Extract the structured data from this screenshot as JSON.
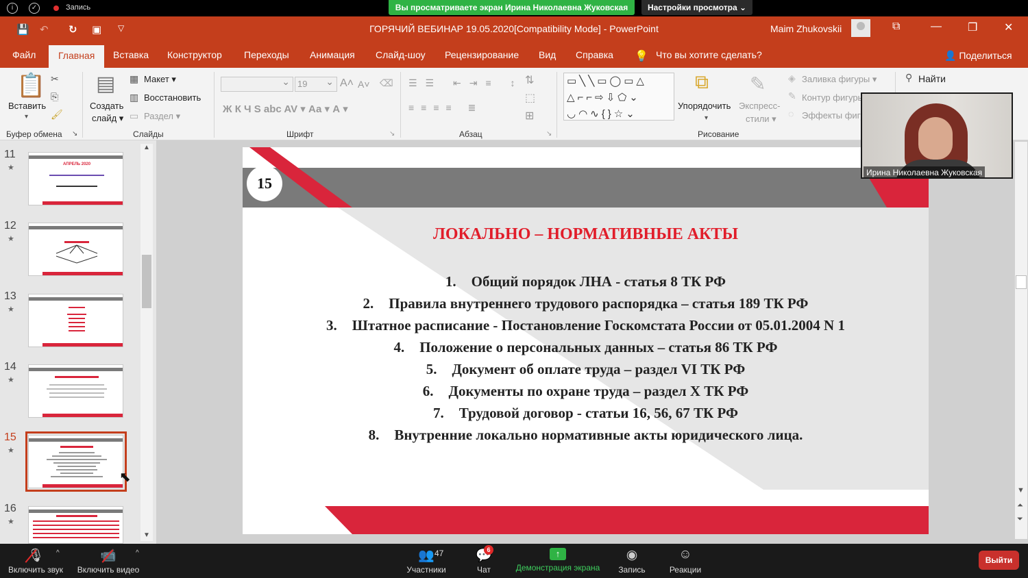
{
  "zoom_top": {
    "recording": "Запись",
    "share_banner": "Вы просматриваете экран Ирина Николаевна Жуковская",
    "view_settings": "Настройки просмотра ⌄"
  },
  "ppt": {
    "title": "ГОРЯЧИЙ ВЕБИНАР 19.05.2020[Compatibility Mode]  -  PowerPoint",
    "user": "Maim Zhukovskii",
    "tabs": [
      "Файл",
      "Главная",
      "Вставка",
      "Конструктор",
      "Переходы",
      "Анимация",
      "Слайд-шоу",
      "Рецензирование",
      "Вид",
      "Справка"
    ],
    "tell_me": "Что вы хотите сделать?",
    "share": "Поделиться"
  },
  "ribbon": {
    "paste": "Вставить",
    "clipboard_group": "Буфер обмена",
    "new_slide_1": "Создать",
    "new_slide_2": "слайд ▾",
    "layout": "Макет ▾",
    "reset": "Восстановить",
    "section": "Раздел ▾",
    "slides_group": "Слайды",
    "font_size": "19",
    "font_group": "Шрифт",
    "font_buttons": "Ж  К  Ч  S  abc  AV ▾  Аа ▾   А ▾",
    "paragraph_group": "Абзац",
    "arrange": "Упорядочить",
    "express_1": "Экспресс-",
    "express_2": "стили ▾",
    "shape_fill": "Заливка фигуры ▾",
    "shape_outline": "Контур фигуры",
    "shape_effects": "Эффекты фигуры",
    "drawing_group": "Рисование",
    "find": "Найти"
  },
  "thumbnails": [
    {
      "num": "11",
      "caption": "АПРЕЛЬ 2020"
    },
    {
      "num": "12",
      "caption": ""
    },
    {
      "num": "13",
      "caption": ""
    },
    {
      "num": "14",
      "caption": ""
    },
    {
      "num": "15",
      "caption": ""
    },
    {
      "num": "16",
      "caption": ""
    }
  ],
  "slide": {
    "number": "15",
    "title": "ЛОКАЛЬНО – НОРМАТИВНЫЕ АКТЫ",
    "items": [
      {
        "n": "1.",
        "text": "Общий порядок ЛНА - статья 8 ТК РФ"
      },
      {
        "n": "2.",
        "text": "Правила внутреннего трудового распорядка – статья 189 ТК РФ"
      },
      {
        "n": "3.",
        "text": "Штатное расписание  - Постановление Госкомстата России от 05.01.2004 N 1"
      },
      {
        "n": "4.",
        "text": "Положение о персональных данных – статья 86 ТК РФ"
      },
      {
        "n": "5.",
        "text": "Документ об оплате труда – раздел VI ТК РФ"
      },
      {
        "n": "6.",
        "text": "Документы по охране труда – раздел X ТК РФ"
      },
      {
        "n": "7.",
        "text": "Трудовой договор  - статьи 16, 56, 67 ТК РФ"
      },
      {
        "n": "8.",
        "text": "Внутренние локально нормативные акты юридического лица."
      }
    ],
    "colors": {
      "red": "#d9253b",
      "gray": "#7a7a7a",
      "title": "#e11d2a"
    }
  },
  "video": {
    "name": "Ирина Николаевна Жуковская"
  },
  "zoom_bottom": {
    "unmute": "Включить звук",
    "start_video": "Включить видео",
    "participants": "Участники",
    "participants_count": "47",
    "chat": "Чат",
    "chat_badge": "6",
    "share_screen": "Демонстрация экрана",
    "record": "Запись",
    "reactions": "Реакции",
    "leave": "Выйти"
  }
}
